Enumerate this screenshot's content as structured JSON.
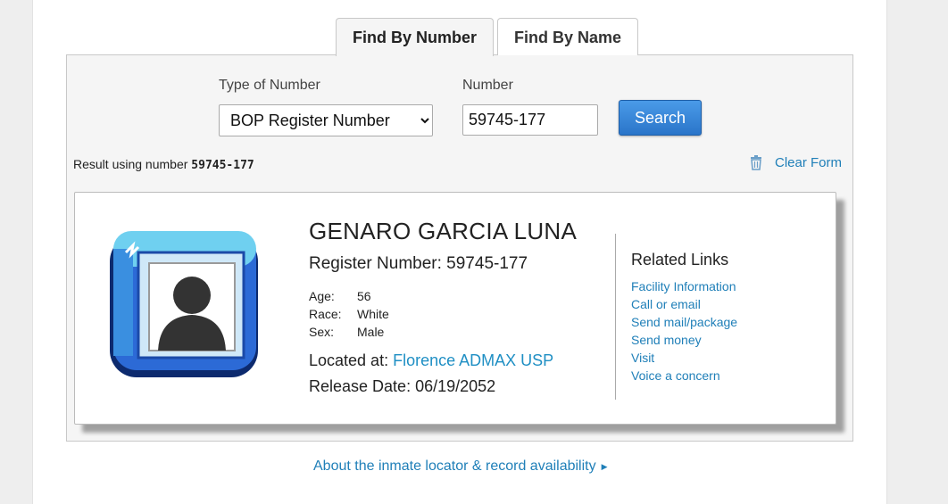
{
  "tabs": [
    {
      "label": "Find By Number",
      "active": true
    },
    {
      "label": "Find By Name",
      "active": false
    }
  ],
  "form": {
    "type_label": "Type of Number",
    "type_selected": "BOP Register Number",
    "number_label": "Number",
    "number_value": "59745-177",
    "search_label": "Search",
    "result_prefix": "Result using number",
    "result_number": "59745-177",
    "clear_label": "Clear Form"
  },
  "inmate": {
    "name": "GENARO GARCIA LUNA",
    "register_label": "Register Number:",
    "register_number": "59745-177",
    "age_label": "Age:",
    "age": "56",
    "race_label": "Race:",
    "race": "White",
    "sex_label": "Sex:",
    "sex": "Male",
    "located_label": "Located at:",
    "facility": "Florence ADMAX USP",
    "release_label": "Release Date:",
    "release_date": "06/19/2052"
  },
  "related": {
    "title": "Related Links",
    "links": [
      "Facility Information",
      "Call or email",
      "Send mail/package",
      "Send money",
      "Visit",
      "Voice a concern"
    ]
  },
  "footer": {
    "about_label": "About the inmate locator & record availability"
  },
  "colors": {
    "link": "#1f7fb8",
    "button": "#2a75c9",
    "panel": "#f5f5f5"
  },
  "icons": {
    "clear": "trash-icon",
    "avatar": "person-placeholder-icon",
    "about": "triangle-right-icon"
  }
}
